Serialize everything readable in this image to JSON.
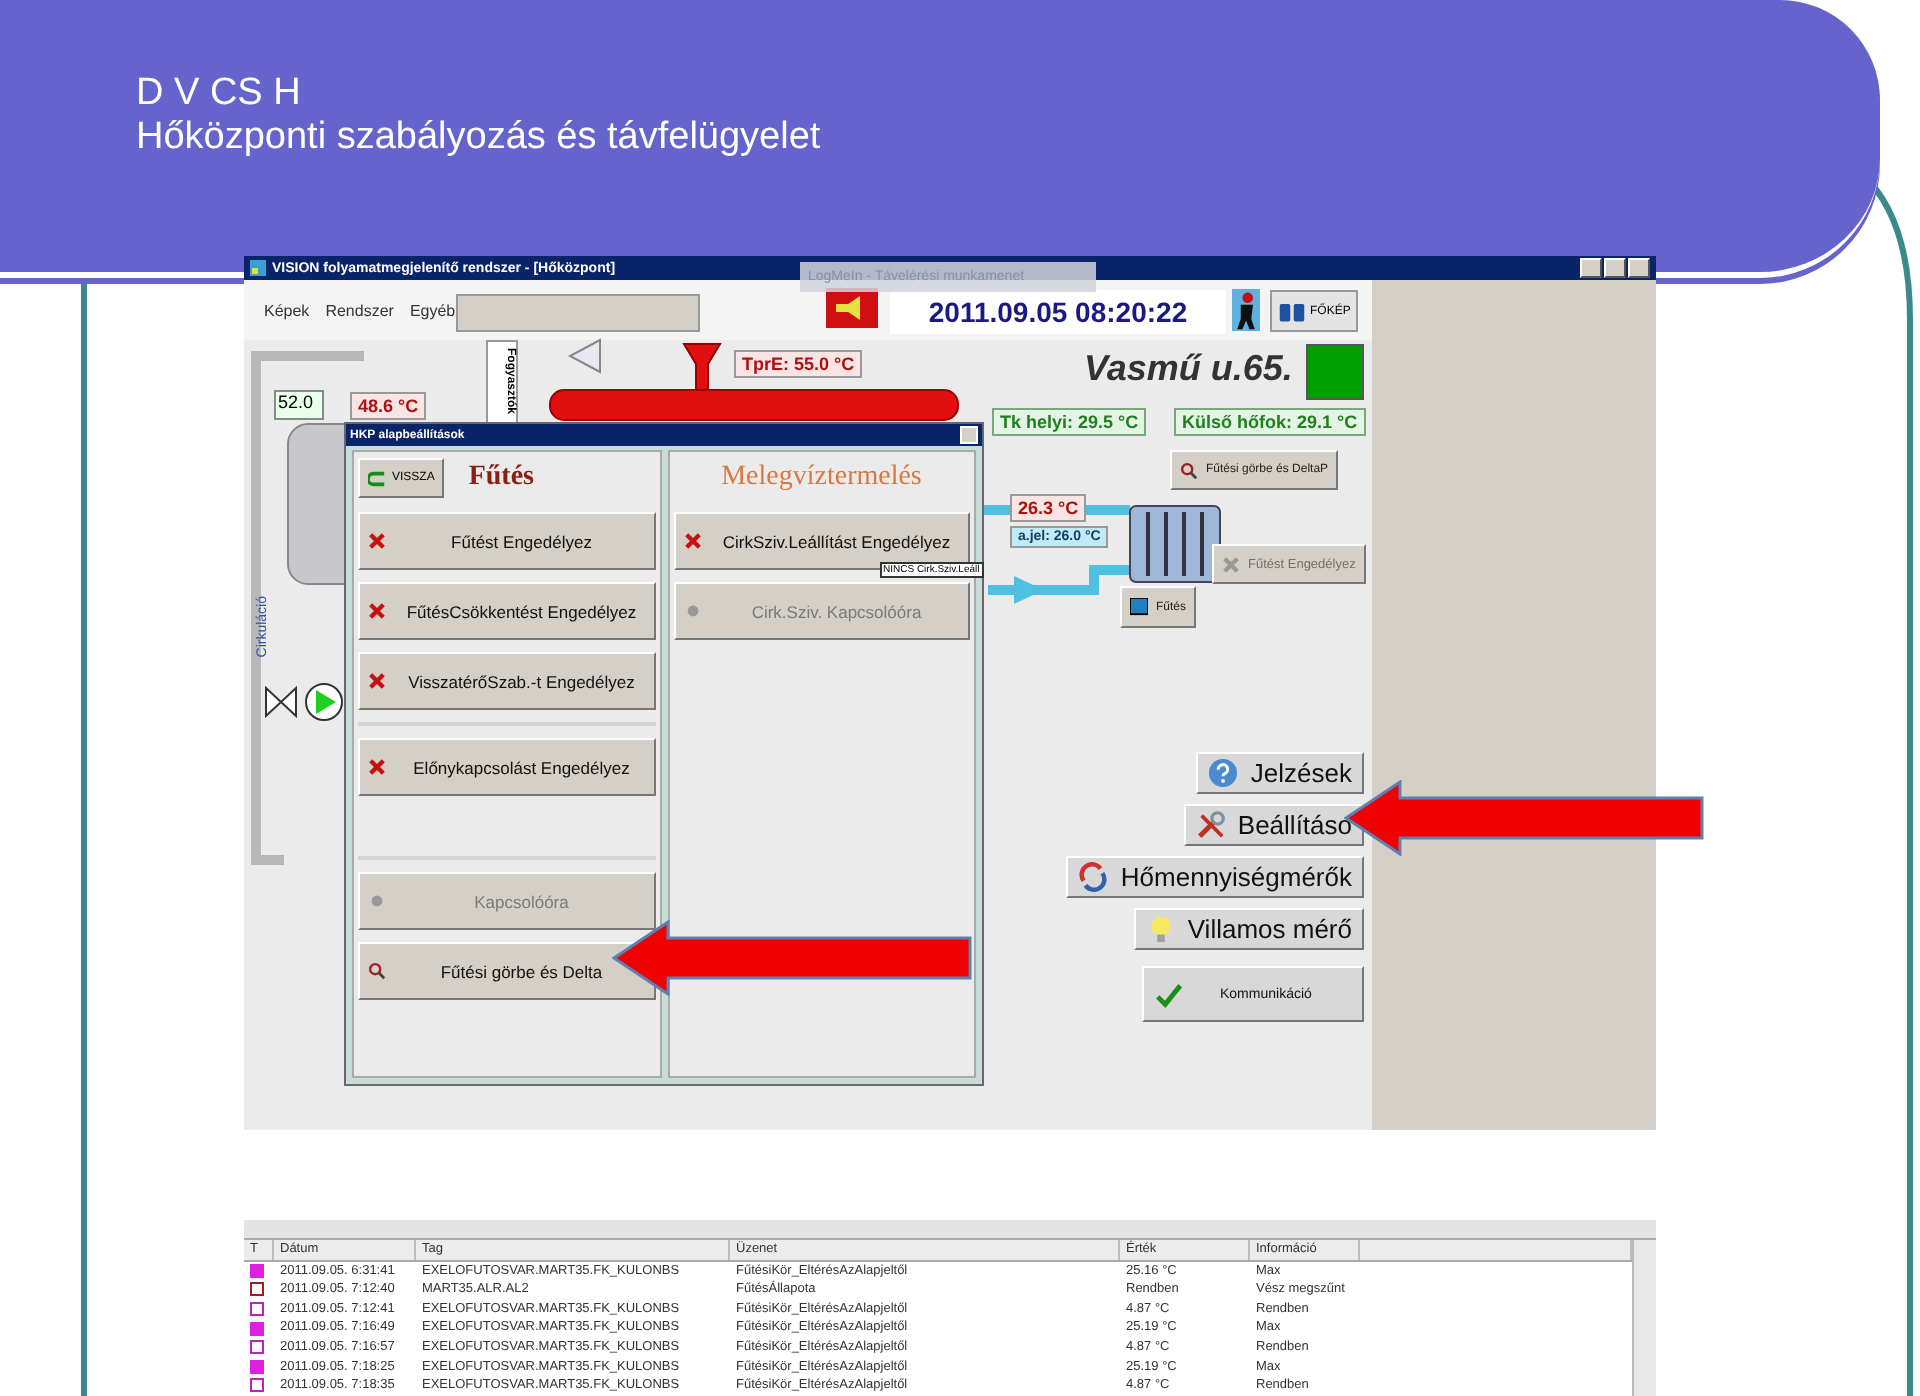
{
  "slide": {
    "title": [
      "D V CS H",
      "Hőközponti szabályozás és távfelügyelet"
    ]
  },
  "window": {
    "title": "VISION folyamatmegjelenítő rendszer - [Hőközpont]",
    "remote_session_tab": "LogMeIn - Távelérési munkamenet"
  },
  "menu": [
    "Képek",
    "Rendszer",
    "Egyéb"
  ],
  "header": {
    "datetime": "2011.09.05 08:20:22",
    "home_button": "FŐKÉP",
    "site": "Vasmű u.65.",
    "site_online": true
  },
  "diagram": {
    "setpoint_input": "52.0",
    "tank_temp": "48.6 °C",
    "consumers_tab": "Fogyasztók",
    "circulation_label": "Cirkuláció",
    "supply_temp": "TprE: 55.0 °C",
    "local_temp": "Tk helyi: 29.5 °C",
    "outdoor_temp": "Külső hőfok: 29.1 °C",
    "curve_button": "Fűtési görbe és DeltaP",
    "flow_temp": "26.3 °C",
    "setpoint": "a.jel: 26.0 °C",
    "enable_button": {
      "label": "Fűtést Engedélyez",
      "disabled": true
    },
    "heating_button": "Fűtés"
  },
  "dialog": {
    "title": "HKP alapbeállítások",
    "back_button": "VISSZA",
    "heating": {
      "title": "Fűtés",
      "groups": [
        {
          "buttons": [
            {
              "label": "Fűtést Engedélyez",
              "kind": "toggle",
              "disabled": false
            },
            {
              "label": "FűtésCsökkentést Engedélyez",
              "kind": "toggle",
              "disabled": false
            },
            {
              "label": "VisszatérőSzab.-t Engedélyez",
              "kind": "toggle",
              "disabled": false
            }
          ]
        },
        {
          "buttons": [
            {
              "label": "Előnykapcsolást Engedélyez",
              "kind": "toggle",
              "disabled": false
            }
          ]
        },
        {
          "buttons": [
            {
              "label": "Kapcsolóóra",
              "kind": "schedule",
              "disabled": true
            },
            {
              "label": "Fűtési görbe és Delta",
              "kind": "curve",
              "disabled": false
            }
          ]
        }
      ]
    },
    "hot_water": {
      "title": "Melegvíztermelés",
      "buttons": [
        {
          "label": "CirkSziv.Leállítást Engedélyez",
          "kind": "toggle",
          "disabled": false
        },
        {
          "label": "Cirk.Sziv. Kapcsolóóra",
          "kind": "schedule",
          "disabled": true
        }
      ],
      "tooltip": "NINCS Cirk.Sziv.Leáll"
    }
  },
  "side_buttons": [
    {
      "label": "Jelzések",
      "kind": "alarms"
    },
    {
      "label": "Beállításo",
      "kind": "settings"
    },
    {
      "label": "Hőmennyiségmérők",
      "kind": "heat_meters"
    },
    {
      "label": "Villamos mérő",
      "kind": "power_meter"
    },
    {
      "label": "Kommunikáció",
      "kind": "communication"
    }
  ],
  "event_log": {
    "columns": [
      "T",
      "Dátum",
      "Tag",
      "Üzenet",
      "Érték",
      "Információ"
    ],
    "rows": [
      {
        "marker": {
          "kind": "filled",
          "color": "#e020e0"
        },
        "date": "2011.09.05. 6:31:41",
        "tag": "EXELOFUTOSVAR.MART35.FK_KULONBS",
        "message": "FűtésiKör_EltérésAzAlapjeltől",
        "value": "25.16 °C",
        "info": "Max"
      },
      {
        "marker": {
          "kind": "outline",
          "color": "#a02020"
        },
        "date": "2011.09.05. 7:12:40",
        "tag": "MART35.ALR.AL2",
        "message": "FűtésÁllapota",
        "value": "Rendben",
        "info": "Vész megszűnt"
      },
      {
        "marker": {
          "kind": "outline",
          "color": "#c020c0"
        },
        "date": "2011.09.05. 7:12:41",
        "tag": "EXELOFUTOSVAR.MART35.FK_KULONBS",
        "message": "FűtésiKör_EltérésAzAlapjeltől",
        "value": "4.87 °C",
        "info": "Rendben"
      },
      {
        "marker": {
          "kind": "filled",
          "color": "#e020e0"
        },
        "date": "2011.09.05. 7:16:49",
        "tag": "EXELOFUTOSVAR.MART35.FK_KULONBS",
        "message": "FűtésiKör_EltérésAzAlapjeltől",
        "value": "25.19 °C",
        "info": "Max"
      },
      {
        "marker": {
          "kind": "outline",
          "color": "#c020c0"
        },
        "date": "2011.09.05. 7:16:57",
        "tag": "EXELOFUTOSVAR.MART35.FK_KULONBS",
        "message": "FűtésiKör_EltérésAzAlapjeltől",
        "value": "4.87 °C",
        "info": "Rendben"
      },
      {
        "marker": {
          "kind": "filled",
          "color": "#e020e0"
        },
        "date": "2011.09.05. 7:18:25",
        "tag": "EXELOFUTOSVAR.MART35.FK_KULONBS",
        "message": "FűtésiKör_EltérésAzAlapjeltől",
        "value": "25.19 °C",
        "info": "Max"
      },
      {
        "marker": {
          "kind": "outline",
          "color": "#c020c0"
        },
        "date": "2011.09.05. 7:18:35",
        "tag": "EXELOFUTOSVAR.MART35.FK_KULONBS",
        "message": "FűtésiKör_EltérésAzAlapjeltől",
        "value": "4.87 °C",
        "info": "Rendben"
      }
    ]
  }
}
